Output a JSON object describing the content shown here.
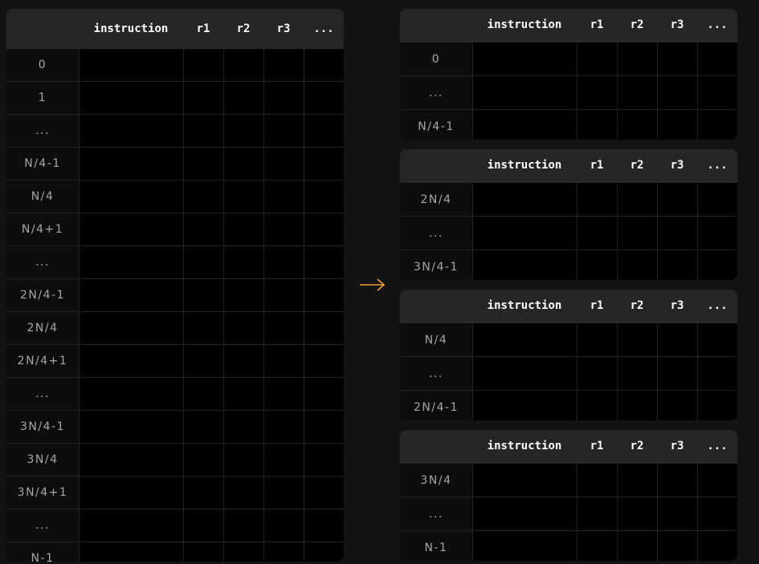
{
  "header": {
    "columns": [
      "",
      "instruction",
      "r1",
      "r2",
      "r3",
      "..."
    ]
  },
  "left_table": {
    "rows": [
      "0",
      "1",
      "...",
      "N/4-1",
      "N/4",
      "N/4+1",
      "...",
      "2N/4-1",
      "2N/4",
      "2N/4+1",
      "...",
      "3N/4-1",
      "3N/4",
      "3N/4+1",
      "...",
      "N-1"
    ]
  },
  "right_tables": [
    {
      "rows": [
        "0",
        "...",
        "N/4-1"
      ]
    },
    {
      "rows": [
        "2N/4",
        "...",
        "3N/4-1"
      ]
    },
    {
      "rows": [
        "N/4",
        "...",
        "2N/4-1"
      ]
    },
    {
      "rows": [
        "3N/4",
        "...",
        "N-1"
      ]
    }
  ],
  "colors": {
    "background": "#131313",
    "table_body": "#000000",
    "header_bg": "#262626",
    "arrow": "#f0a030"
  }
}
